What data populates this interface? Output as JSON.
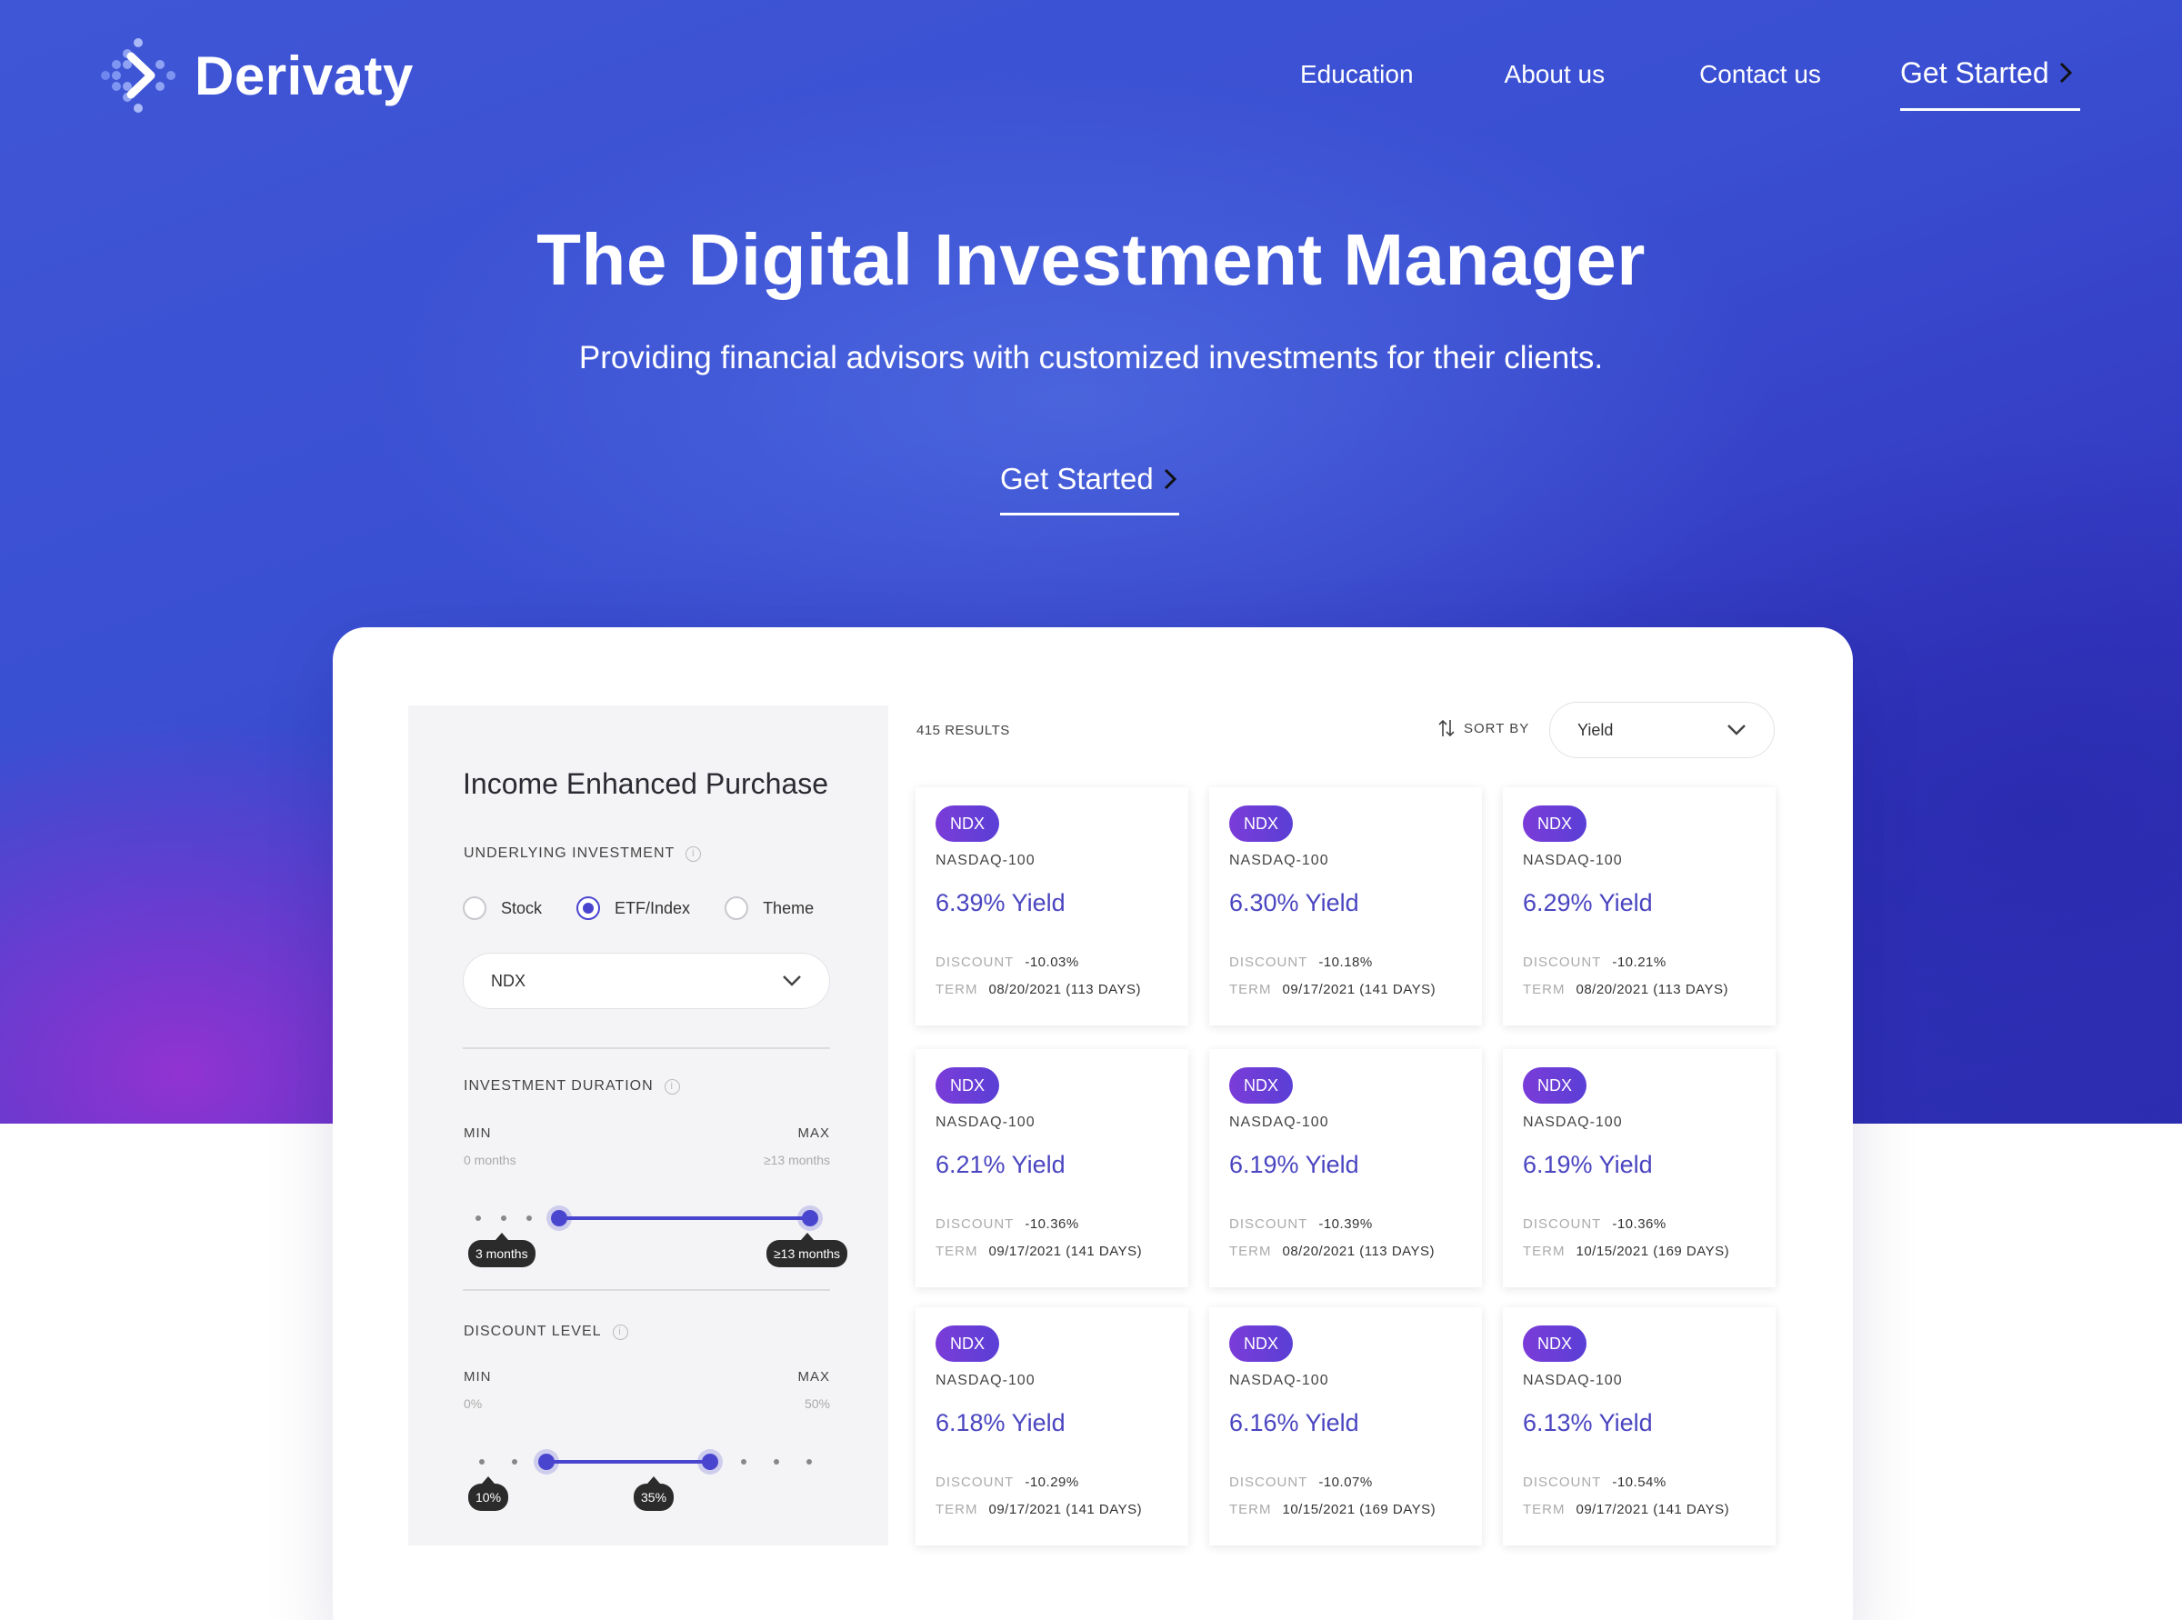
{
  "brand": {
    "name": "Derivaty"
  },
  "nav": {
    "items": [
      "Education",
      "About us",
      "Contact us"
    ],
    "cta": "Get Started"
  },
  "hero": {
    "title": "The Digital Investment Manager",
    "subtitle": "Providing financial advisors with customized investments for their clients.",
    "cta": "Get Started"
  },
  "colors": {
    "accent": "#4a45cf",
    "badge": "#6a3dd6",
    "hero_bg": "#3a4fd2"
  },
  "sidebar": {
    "title": "Income Enhanced Purchase",
    "underlying_label": "UNDERLYING INVESTMENT",
    "radio_options": [
      "Stock",
      "ETF/Index",
      "Theme"
    ],
    "radio_selected": "ETF/Index",
    "select_value": "NDX",
    "duration": {
      "label": "INVESTMENT DURATION",
      "min_label": "MIN",
      "max_label": "MAX",
      "min_value": "0 months",
      "max_value": "≥13 months",
      "low_tip": "3 months",
      "high_tip": "≥13 months"
    },
    "discount": {
      "label": "DISCOUNT LEVEL",
      "min_label": "MIN",
      "max_label": "MAX",
      "min_value": "0%",
      "max_value": "50%",
      "low_tip": "10%",
      "high_tip": "35%"
    }
  },
  "results": {
    "count": "415 RESULTS",
    "sort_label": "SORT BY",
    "sort_value": "Yield",
    "discount_key": "DISCOUNT",
    "term_key": "TERM",
    "cards": [
      {
        "badge": "NDX",
        "name": "NASDAQ-100",
        "yield": "6.39% Yield",
        "discount": "-10.03%",
        "term": "08/20/2021 (113 DAYS)"
      },
      {
        "badge": "NDX",
        "name": "NASDAQ-100",
        "yield": "6.30% Yield",
        "discount": "-10.18%",
        "term": "09/17/2021 (141 DAYS)"
      },
      {
        "badge": "NDX",
        "name": "NASDAQ-100",
        "yield": "6.29% Yield",
        "discount": "-10.21%",
        "term": "08/20/2021 (113 DAYS)"
      },
      {
        "badge": "NDX",
        "name": "NASDAQ-100",
        "yield": "6.21% Yield",
        "discount": "-10.36%",
        "term": "09/17/2021 (141 DAYS)"
      },
      {
        "badge": "NDX",
        "name": "NASDAQ-100",
        "yield": "6.19% Yield",
        "discount": "-10.39%",
        "term": "08/20/2021 (113 DAYS)"
      },
      {
        "badge": "NDX",
        "name": "NASDAQ-100",
        "yield": "6.19% Yield",
        "discount": "-10.36%",
        "term": "10/15/2021 (169 DAYS)"
      },
      {
        "badge": "NDX",
        "name": "NASDAQ-100",
        "yield": "6.18% Yield",
        "discount": "-10.29%",
        "term": "09/17/2021 (141 DAYS)"
      },
      {
        "badge": "NDX",
        "name": "NASDAQ-100",
        "yield": "6.16% Yield",
        "discount": "-10.07%",
        "term": "10/15/2021 (169 DAYS)"
      },
      {
        "badge": "NDX",
        "name": "NASDAQ-100",
        "yield": "6.13% Yield",
        "discount": "-10.54%",
        "term": "09/17/2021 (141 DAYS)"
      }
    ]
  }
}
